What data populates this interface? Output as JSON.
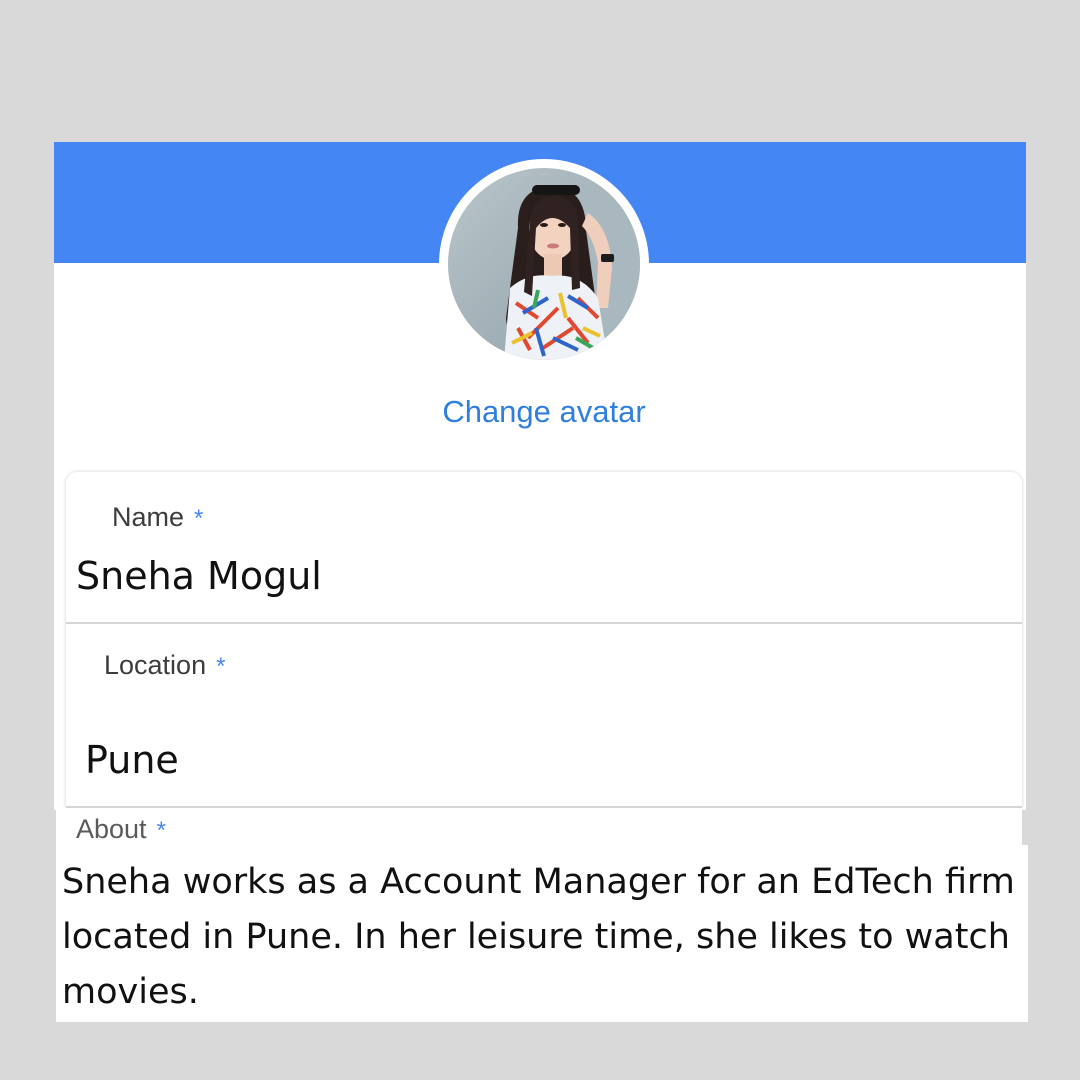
{
  "profile": {
    "change_avatar_label": "Change avatar",
    "fields": {
      "name": {
        "label": "Name",
        "required_mark": "*",
        "value": "Sneha Mogul"
      },
      "location": {
        "label": "Location",
        "required_mark": "*",
        "value": "Pune"
      },
      "about": {
        "label": "About",
        "required_mark": "*",
        "value": "Sneha works as a Account Manager for an EdTech firm located in Pune. In her leisure time, she likes to watch movies."
      }
    }
  },
  "colors": {
    "header": "#4586f5",
    "link": "#2f7fde",
    "required": "#4586f5",
    "background": "#d9d9d9"
  }
}
